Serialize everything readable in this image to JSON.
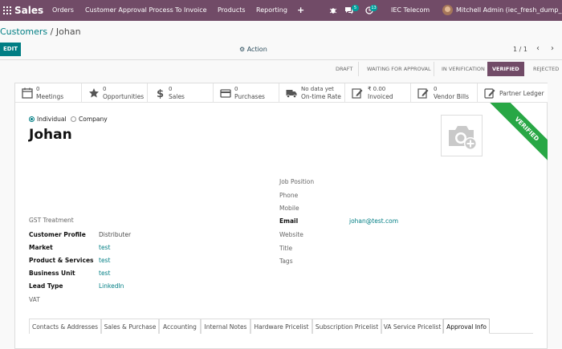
{
  "topbar": {
    "app_name": "Sales",
    "menu": [
      "Orders",
      "Customer Approval Process",
      "To Invoice",
      "Products",
      "Reporting"
    ],
    "plus": "+",
    "messages_count": "5",
    "activities_count": "13",
    "company": "IEC Telecom",
    "user": "Mitchell Admin (iec_fresh_dump_cust)"
  },
  "breadcrumb": {
    "parent": "Customers",
    "separator": "/",
    "current": "Johan"
  },
  "controls": {
    "edit": "EDIT",
    "action": "⚙ Action",
    "pager": "1 / 1",
    "prev": "‹",
    "next": "›"
  },
  "status": {
    "stages": [
      "DRAFT",
      "WAITING FOR APPROVAL",
      "IN VERIFICATION",
      "VERIFIED",
      "REJECTED"
    ],
    "active": "VERIFIED"
  },
  "smart_buttons": [
    {
      "num": "0",
      "label": "Meetings",
      "icon": "calendar-icon"
    },
    {
      "num": "0",
      "label": "Opportunities",
      "icon": "star-icon"
    },
    {
      "num": "0",
      "label": "Sales",
      "icon": "dollar-icon"
    },
    {
      "num": "0",
      "label": "Purchases",
      "icon": "credit-card-icon"
    },
    {
      "num": "No data yet",
      "label": "On-time Rate",
      "icon": "truck-icon"
    },
    {
      "num": "₹ 0.00",
      "label": "Invoiced",
      "icon": "pencil-square-icon"
    },
    {
      "num": "0",
      "label": "Vendor Bills",
      "icon": "pencil-square-icon"
    },
    {
      "num": "",
      "label": "Partner Ledger",
      "icon": "edit-icon"
    }
  ],
  "ribbon": "VERIFIED",
  "company_type": {
    "individual": "Individual",
    "company": "Company",
    "selected": "Individual"
  },
  "partner_name": "Johan",
  "left_fields": {
    "gst_treatment": {
      "label": "GST Treatment",
      "value": ""
    },
    "customer_profile": {
      "label": "Customer Profile",
      "value": "Distributer"
    },
    "market": {
      "label": "Market",
      "value": "test"
    },
    "product_services": {
      "label": "Product & Services",
      "value": "test"
    },
    "business_unit": {
      "label": "Business Unit",
      "value": "test"
    },
    "lead_type": {
      "label": "Lead Type",
      "value": "LinkedIn"
    },
    "vat": {
      "label": "VAT",
      "value": ""
    }
  },
  "right_fields": {
    "job_position": "Job Position",
    "phone": "Phone",
    "mobile": "Mobile",
    "email_label": "Email",
    "email_value": "johan@test.com",
    "website": "Website",
    "title": "Title",
    "tags": "Tags"
  },
  "tabs": [
    "Contacts & Addresses",
    "Sales & Purchase",
    "Accounting",
    "Internal Notes",
    "Hardware Pricelist",
    "Subscription Pricelist",
    "VA Service Pricelist",
    "Approval Info"
  ],
  "active_tab": "Approval Info",
  "colors": {
    "brand": "#714B67",
    "accent": "#017e84",
    "verified": "#28a745"
  }
}
